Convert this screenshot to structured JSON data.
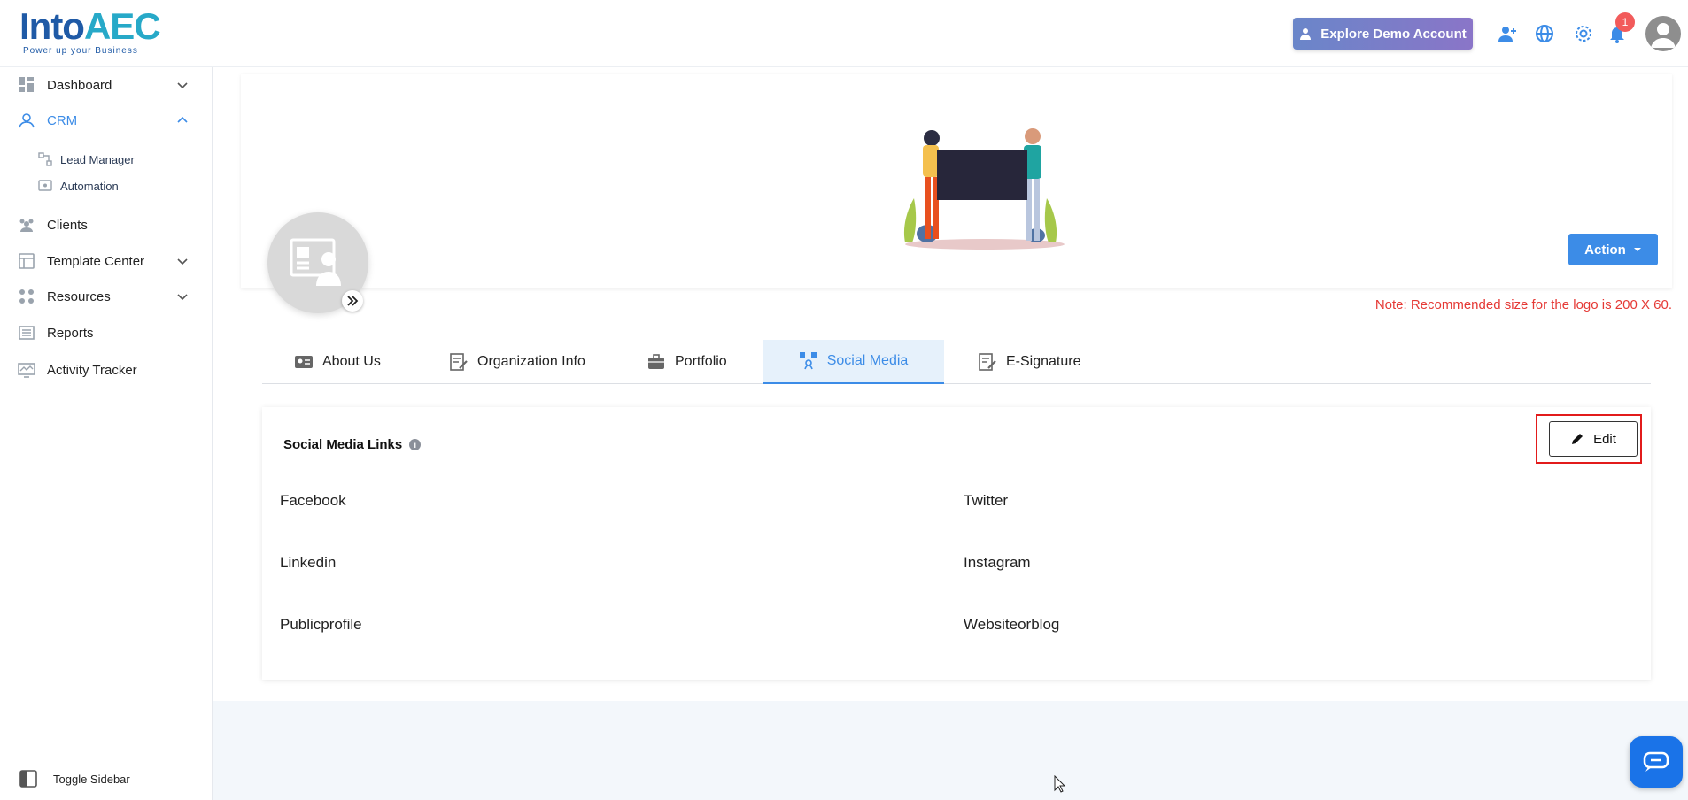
{
  "app": {
    "logo_text_into": "Into",
    "logo_text_aec": "AEC",
    "tagline": "Power up your Business"
  },
  "header": {
    "demo_button": "Explore Demo Account",
    "notification_count": "1"
  },
  "sidebar": {
    "items": [
      {
        "label": "Dashboard",
        "icon": "dashboard-icon",
        "chevron": "down"
      },
      {
        "label": "CRM",
        "icon": "crm-icon",
        "chevron": "up",
        "active": true
      },
      {
        "label": "Clients",
        "icon": "clients-icon"
      },
      {
        "label": "Template Center",
        "icon": "template-icon",
        "chevron": "down"
      },
      {
        "label": "Resources",
        "icon": "resources-icon",
        "chevron": "down"
      },
      {
        "label": "Reports",
        "icon": "reports-icon"
      },
      {
        "label": "Activity Tracker",
        "icon": "activity-icon"
      }
    ],
    "crm_sub": [
      {
        "label": "Lead Manager",
        "icon": "lead-manager-icon"
      },
      {
        "label": "Automation",
        "icon": "automation-icon"
      }
    ],
    "toggle_label": "Toggle Sidebar"
  },
  "profile": {
    "action_label": "Action",
    "note": "Note: Recommended size for the logo is 200 X 60."
  },
  "tabs": [
    {
      "label": "About Us",
      "icon": "id-card-icon"
    },
    {
      "label": "Organization Info",
      "icon": "edit-document-icon"
    },
    {
      "label": "Portfolio",
      "icon": "briefcase-icon"
    },
    {
      "label": "Social Media",
      "icon": "social-media-icon",
      "active": true
    },
    {
      "label": "E-Signature",
      "icon": "signature-icon"
    }
  ],
  "social": {
    "title": "Social Media Links",
    "edit_label": "Edit",
    "fields": [
      {
        "label": "Facebook"
      },
      {
        "label": "Twitter"
      },
      {
        "label": "Linkedin"
      },
      {
        "label": "Instagram"
      },
      {
        "label": "Publicprofile"
      },
      {
        "label": "Websiteorblog"
      }
    ]
  },
  "colors": {
    "accent": "#3c8ce7",
    "note_red": "#e53935",
    "highlight_red": "#e21b1b"
  }
}
